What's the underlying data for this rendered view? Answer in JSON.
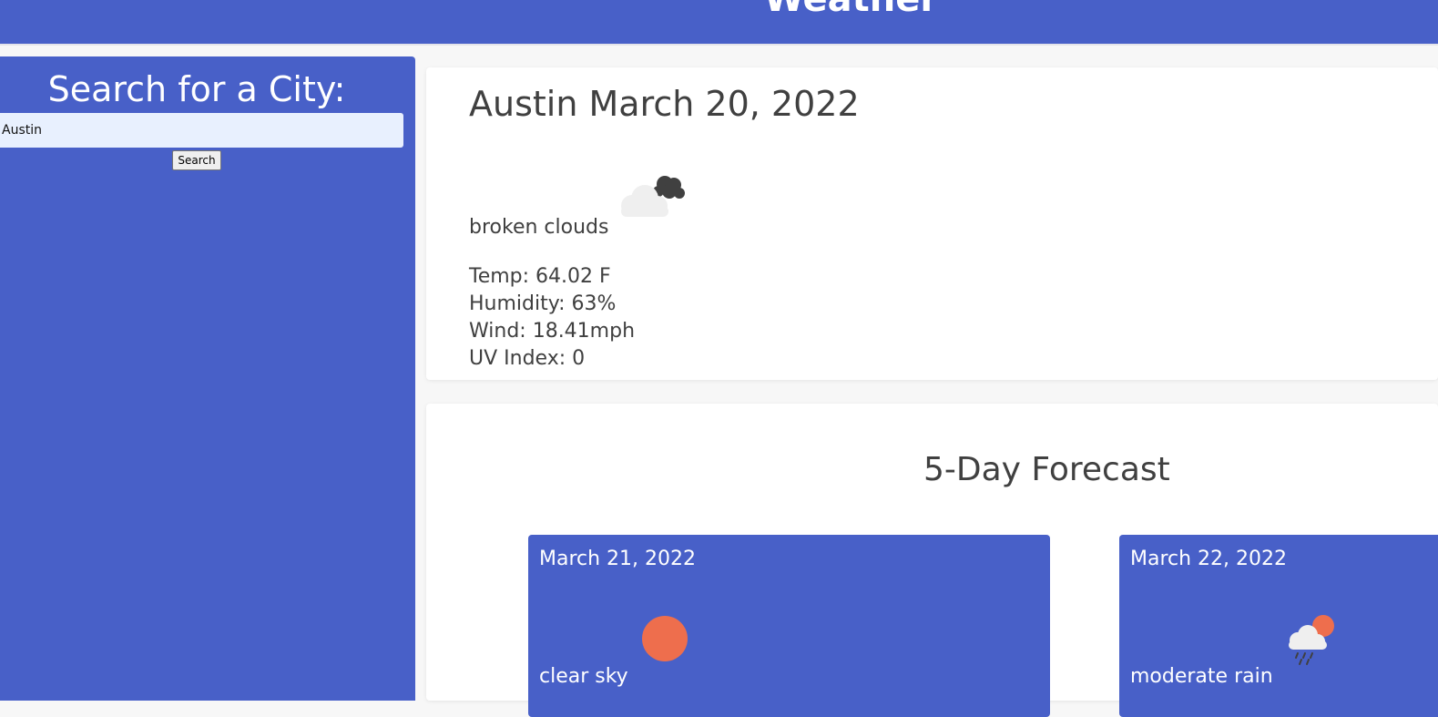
{
  "header": {
    "title": "Weather"
  },
  "sidebar": {
    "title": "Search for a City:",
    "search_value": "Austin",
    "search_button_label": "Search"
  },
  "current": {
    "city_date": "Austin March 20, 2022",
    "icon": "broken-clouds-icon",
    "description": "broken clouds",
    "temp": "Temp: 64.02 F",
    "humidity": "Humidity: 63%",
    "wind": "Wind: 18.41mph",
    "uv": "UV Index: 0"
  },
  "forecast": {
    "title": "5-Day Forecast",
    "days": [
      {
        "date": "March 21, 2022",
        "icon": "clear-sky-icon",
        "description": "clear sky"
      },
      {
        "date": "March 22, 2022",
        "icon": "moderate-rain-icon",
        "description": "moderate rain"
      }
    ]
  },
  "colors": {
    "primary": "#4860c8",
    "sun": "#ee6e4d",
    "text": "#404040"
  }
}
